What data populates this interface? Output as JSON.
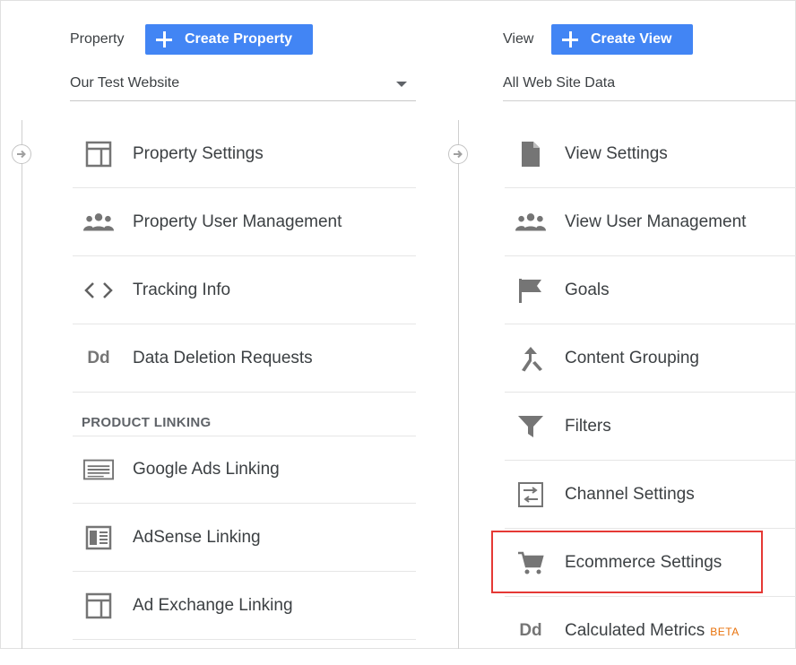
{
  "property": {
    "label": "Property",
    "create_button": "Create Property",
    "selected": "Our Test Website"
  },
  "view": {
    "label": "View",
    "create_button": "Create View",
    "selected": "All Web Site Data"
  },
  "property_items": [
    {
      "label": "Property Settings",
      "icon": "layout-icon"
    },
    {
      "label": "Property User Management",
      "icon": "people-icon"
    },
    {
      "label": "Tracking Info",
      "icon": "code-icon"
    },
    {
      "label": "Data Deletion Requests",
      "icon": "dd-icon",
      "icon_text": "Dd"
    }
  ],
  "product_linking": {
    "heading": "PRODUCT LINKING",
    "items": [
      {
        "label": "Google Ads Linking",
        "icon": "ads-icon"
      },
      {
        "label": "AdSense Linking",
        "icon": "adsense-icon"
      },
      {
        "label": "Ad Exchange Linking",
        "icon": "layout-icon"
      }
    ]
  },
  "view_items": [
    {
      "label": "View Settings",
      "icon": "document-icon"
    },
    {
      "label": "View User Management",
      "icon": "people-icon"
    },
    {
      "label": "Goals",
      "icon": "flag-icon"
    },
    {
      "label": "Content Grouping",
      "icon": "merge-icon"
    },
    {
      "label": "Filters",
      "icon": "filter-icon"
    },
    {
      "label": "Channel Settings",
      "icon": "channel-icon"
    },
    {
      "label": "Ecommerce Settings",
      "icon": "cart-icon"
    },
    {
      "label": "Calculated Metrics",
      "icon": "dd-icon",
      "icon_text": "Dd",
      "badge": "BETA"
    }
  ],
  "colors": {
    "accent": "#4285f4",
    "highlight": "#e53935",
    "beta": "#e8710a"
  }
}
